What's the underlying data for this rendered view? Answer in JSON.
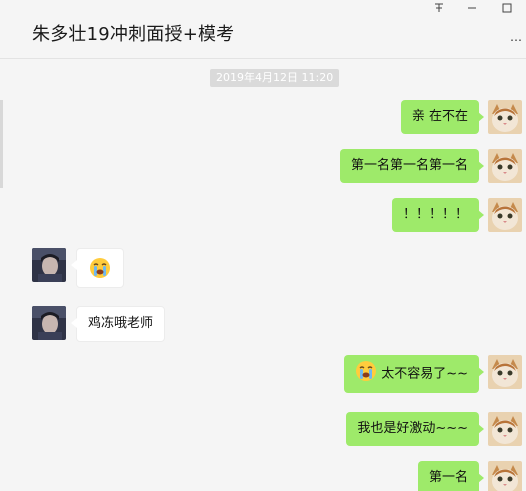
{
  "window": {
    "title": "朱多壮19冲刺面授+模考",
    "pin_icon": "pin-icon",
    "minimize_icon": "minimize-icon",
    "maximize_icon": "maximize-icon",
    "more_label": "…"
  },
  "chat": {
    "timestamp": "2019年4月12日 11:20",
    "messages": [
      {
        "side": "right",
        "text": "亲 在不在",
        "avatar": "cat-avatar"
      },
      {
        "side": "right",
        "text": "第一名第一名第一名",
        "avatar": "cat-avatar"
      },
      {
        "side": "right",
        "text": "！！！！！",
        "avatar": "cat-avatar"
      },
      {
        "side": "left",
        "text": "",
        "emoji": "crying-face",
        "avatar": "person-avatar"
      },
      {
        "side": "left",
        "text": "鸡冻哦老师",
        "avatar": "person-avatar"
      },
      {
        "side": "right",
        "text": "太不容易了~~",
        "emoji": "crying-face",
        "avatar": "cat-avatar"
      },
      {
        "side": "right",
        "text": "我也是好激动~~~",
        "avatar": "cat-avatar"
      },
      {
        "side": "right",
        "text": "第一名",
        "avatar": "cat-avatar"
      }
    ]
  },
  "colors": {
    "sent_bubble": "#9eea6a",
    "recv_bubble": "#ffffff",
    "background": "#f5f5f5",
    "timestamp_bg": "#dadada"
  }
}
